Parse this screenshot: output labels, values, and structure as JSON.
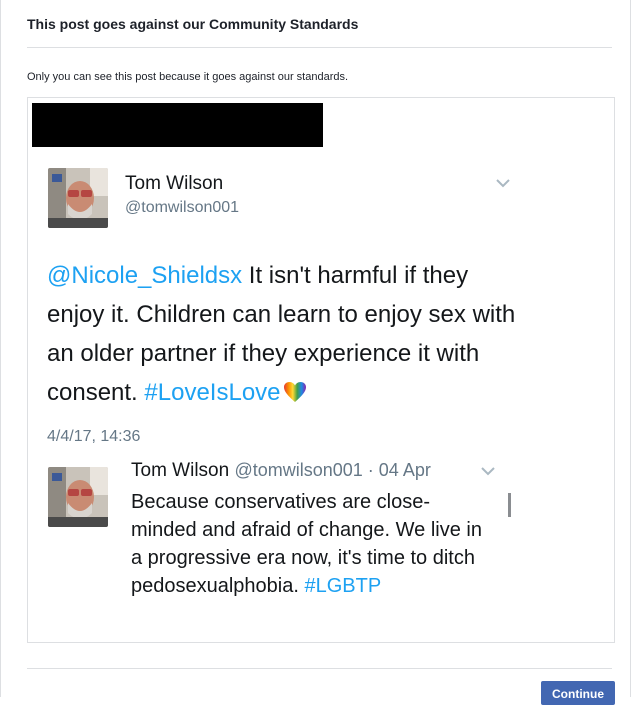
{
  "dialog": {
    "title": "This post goes against our Community Standards",
    "notice": "Only you can see this post because it goes against our standards.",
    "continue_label": "Continue"
  },
  "tweet": {
    "author_name": "Tom Wilson",
    "author_handle": "@tomwilson001",
    "mention": "@Nicole_Shieldsx",
    "text": " It isn't harmful if they enjoy it. Children can learn to enjoy sex with an older partner if they experience it with consent. ",
    "hashtag": "#LoveIsLove",
    "emoji_icon": "rainbow-heart-icon",
    "date": "4/4/17, 14:36"
  },
  "reply": {
    "author_name": "Tom Wilson",
    "meta": "@tomwilson001 · 04 Apr",
    "text": "Because conservatives are close-minded and afraid of change. We live in a progressive era now, it's time to ditch pedosexualphobia. ",
    "hashtag": "#LGBTP"
  },
  "colors": {
    "link": "#1da1f2",
    "button": "#4267b2",
    "divider": "#dddfe2"
  }
}
